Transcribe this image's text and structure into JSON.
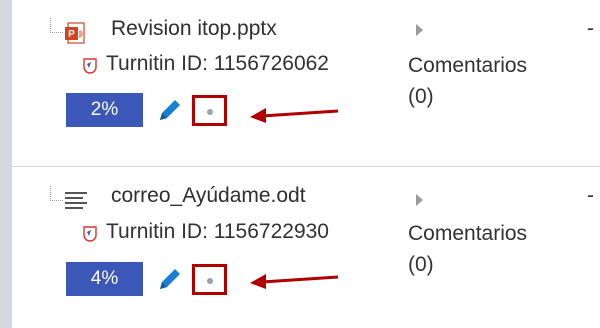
{
  "submissions": [
    {
      "filename": "Revision itop.pptx",
      "file_icon": "powerpoint-file-icon",
      "turnitin_label": "Turnitin ID: 1156726062",
      "comments_label": "Comentarios",
      "comments_count": "(0)",
      "score": "2%",
      "trailing": "-"
    },
    {
      "filename": "correo_Ayúdame.odt",
      "file_icon": "text-document-icon",
      "turnitin_label": "Turnitin ID: 1156722930",
      "comments_label": "Comentarios",
      "comments_count": "(0)",
      "score": "4%",
      "trailing": "-"
    }
  ],
  "colors": {
    "score_bg": "#3b57b8",
    "highlight_red": "#b00000",
    "pencil_blue": "#1a7fd4",
    "background": "#d2d8de"
  },
  "icons": [
    "powerpoint-file-icon",
    "text-document-icon",
    "turnitin-icon",
    "expand-arrow-icon",
    "edit-pencil-icon",
    "dot-icon",
    "annotation-arrow"
  ]
}
